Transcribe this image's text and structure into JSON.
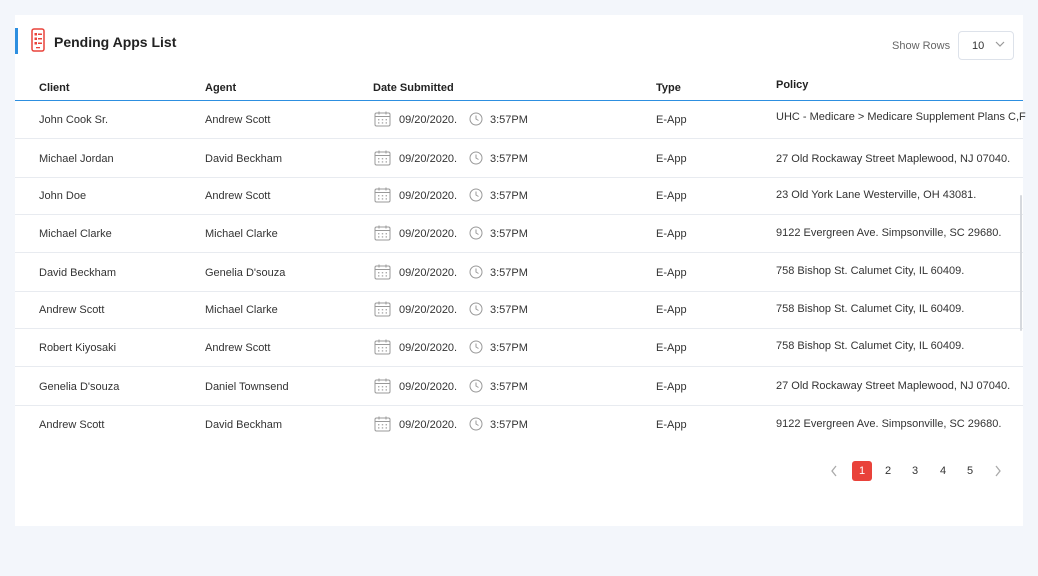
{
  "header": {
    "title": "Pending Apps List",
    "show_rows_label": "Show Rows",
    "rows_value": "10"
  },
  "columns": [
    "Client",
    "Agent",
    "Date Submitted",
    "Type",
    "Policy"
  ],
  "rows": [
    {
      "client": "John Cook Sr.",
      "agent": "Andrew Scott",
      "date": "09/20/2020.",
      "time": "3:57PM",
      "type": "E-App",
      "policy": "UHC - Medicare > Medicare Supplement Plans C,F"
    },
    {
      "client": "Michael Jordan",
      "agent": "David Beckham",
      "date": "09/20/2020.",
      "time": "3:57PM",
      "type": "E-App",
      "policy": "27 Old Rockaway Street Maplewood, NJ 07040."
    },
    {
      "client": "John Doe",
      "agent": "Andrew Scott",
      "date": "09/20/2020.",
      "time": "3:57PM",
      "type": "E-App",
      "policy": "23 Old York Lane Westerville, OH 43081."
    },
    {
      "client": "Michael Clarke",
      "agent": "Michael Clarke",
      "date": "09/20/2020.",
      "time": "3:57PM",
      "type": "E-App",
      "policy": "9122 Evergreen Ave. Simpsonville, SC 29680."
    },
    {
      "client": "David Beckham",
      "agent": "Genelia D'souza",
      "date": "09/20/2020.",
      "time": "3:57PM",
      "type": "E-App",
      "policy": "758 Bishop St. Calumet City, IL 60409."
    },
    {
      "client": "Andrew Scott",
      "agent": "Michael Clarke",
      "date": "09/20/2020.",
      "time": "3:57PM",
      "type": "E-App",
      "policy": "758 Bishop St. Calumet City, IL 60409."
    },
    {
      "client": "Robert Kiyosaki",
      "agent": "Andrew Scott",
      "date": "09/20/2020.",
      "time": "3:57PM",
      "type": "E-App",
      "policy": "758 Bishop St. Calumet City, IL 60409."
    },
    {
      "client": "Genelia D'souza",
      "agent": "Daniel Townsend",
      "date": "09/20/2020.",
      "time": "3:57PM",
      "type": "E-App",
      "policy": "27 Old Rockaway Street Maplewood, NJ 07040."
    },
    {
      "client": "Andrew Scott",
      "agent": "David Beckham",
      "date": "09/20/2020.",
      "time": "3:57PM",
      "type": "E-App",
      "policy": "9122 Evergreen Ave. Simpsonville, SC 29680."
    }
  ],
  "pagination": {
    "pages": [
      "1",
      "2",
      "3",
      "4",
      "5"
    ],
    "active_page": "1"
  },
  "colors": {
    "accent": "#2d8fe0",
    "active_page": "#e9423a",
    "title_icon": "#e9423a"
  },
  "icons": {
    "title": "mobile-checklist-icon",
    "date": "calendar-icon",
    "time": "clock-icon",
    "select": "chevron-down-icon",
    "prev": "chevron-left-icon",
    "next": "chevron-right-icon"
  }
}
